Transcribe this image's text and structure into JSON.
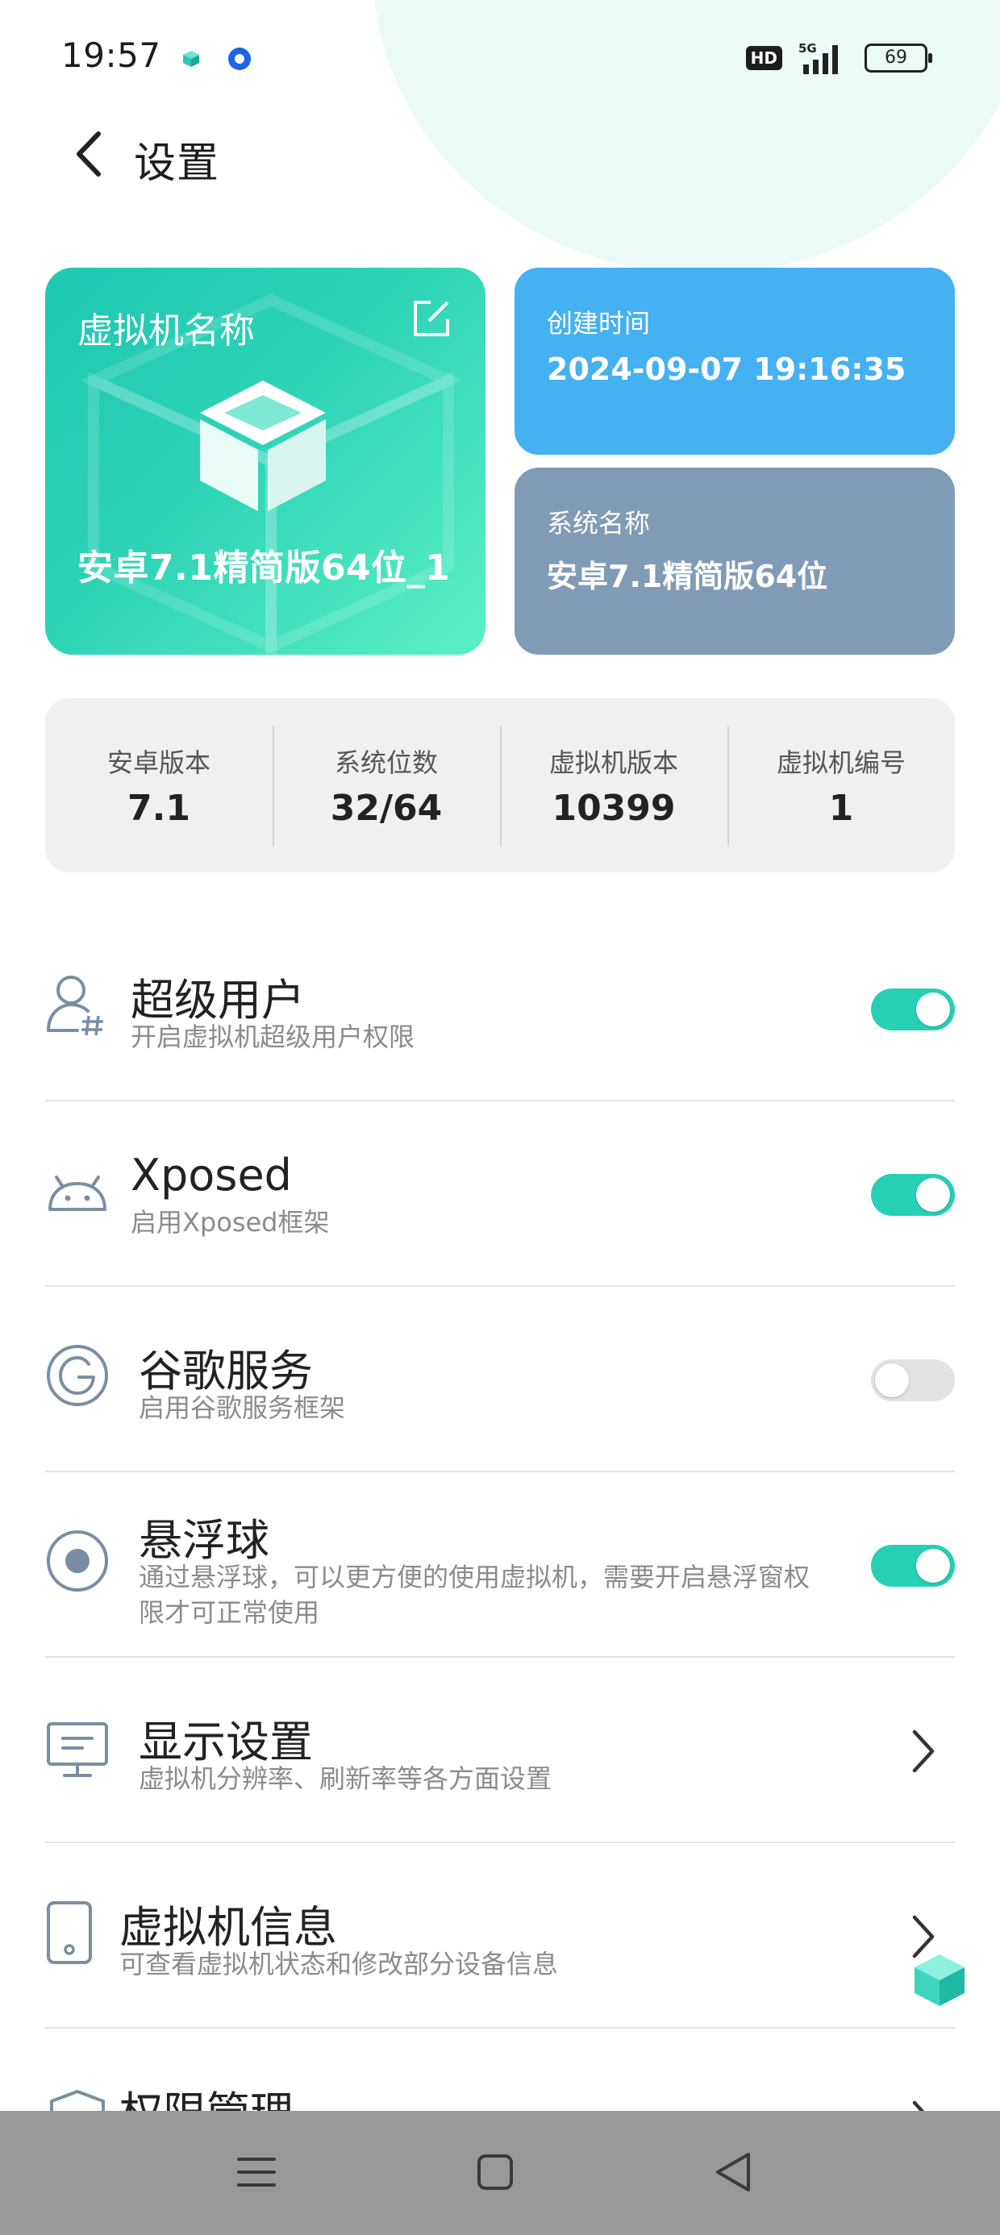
{
  "status_bar": {
    "time": "19:57",
    "hd": "HD",
    "network": "5G",
    "battery": "69"
  },
  "header": {
    "title": "设置"
  },
  "vm_card": {
    "label": "虚拟机名称",
    "name": "安卓7.1精简版64位_1"
  },
  "created_card": {
    "label": "创建时间",
    "value": "2024-09-07 19:16:35"
  },
  "system_card": {
    "label": "系统名称",
    "value": "安卓7.1精简版64位"
  },
  "stats": [
    {
      "label": "安卓版本",
      "value": "7.1"
    },
    {
      "label": "系统位数",
      "value": "32/64"
    },
    {
      "label": "虚拟机版本",
      "value": "10399"
    },
    {
      "label": "虚拟机编号",
      "value": "1"
    }
  ],
  "settings": [
    {
      "title": "超级用户",
      "subtitle": "开启虚拟机超级用户权限",
      "control": "toggle",
      "enabled": true,
      "icon": "superuser-icon"
    },
    {
      "title": "Xposed",
      "subtitle": "启用Xposed框架",
      "control": "toggle",
      "enabled": true,
      "icon": "android-icon"
    },
    {
      "title": "谷歌服务",
      "subtitle": "启用谷歌服务框架",
      "control": "toggle",
      "enabled": false,
      "icon": "google-icon"
    },
    {
      "title": "悬浮球",
      "subtitle": "通过悬浮球，可以更方便的使用虚拟机，需要开启悬浮窗权限才可正常使用",
      "control": "toggle",
      "enabled": true,
      "icon": "floating-ball-icon"
    },
    {
      "title": "显示设置",
      "subtitle": "虚拟机分辨率、刷新率等各方面设置",
      "control": "chevron",
      "icon": "monitor-icon"
    },
    {
      "title": "虚拟机信息",
      "subtitle": "可查看虚拟机状态和修改部分设备信息",
      "control": "chevron",
      "icon": "phone-icon"
    },
    {
      "title": "权限管理",
      "subtitle": "",
      "control": "chevron",
      "icon": "shield-icon"
    }
  ],
  "colors": {
    "accent": "#27cfb4",
    "created_card": "#45b0f2",
    "system_card": "#809bb6",
    "icon_gray": "#7a8ea3"
  }
}
